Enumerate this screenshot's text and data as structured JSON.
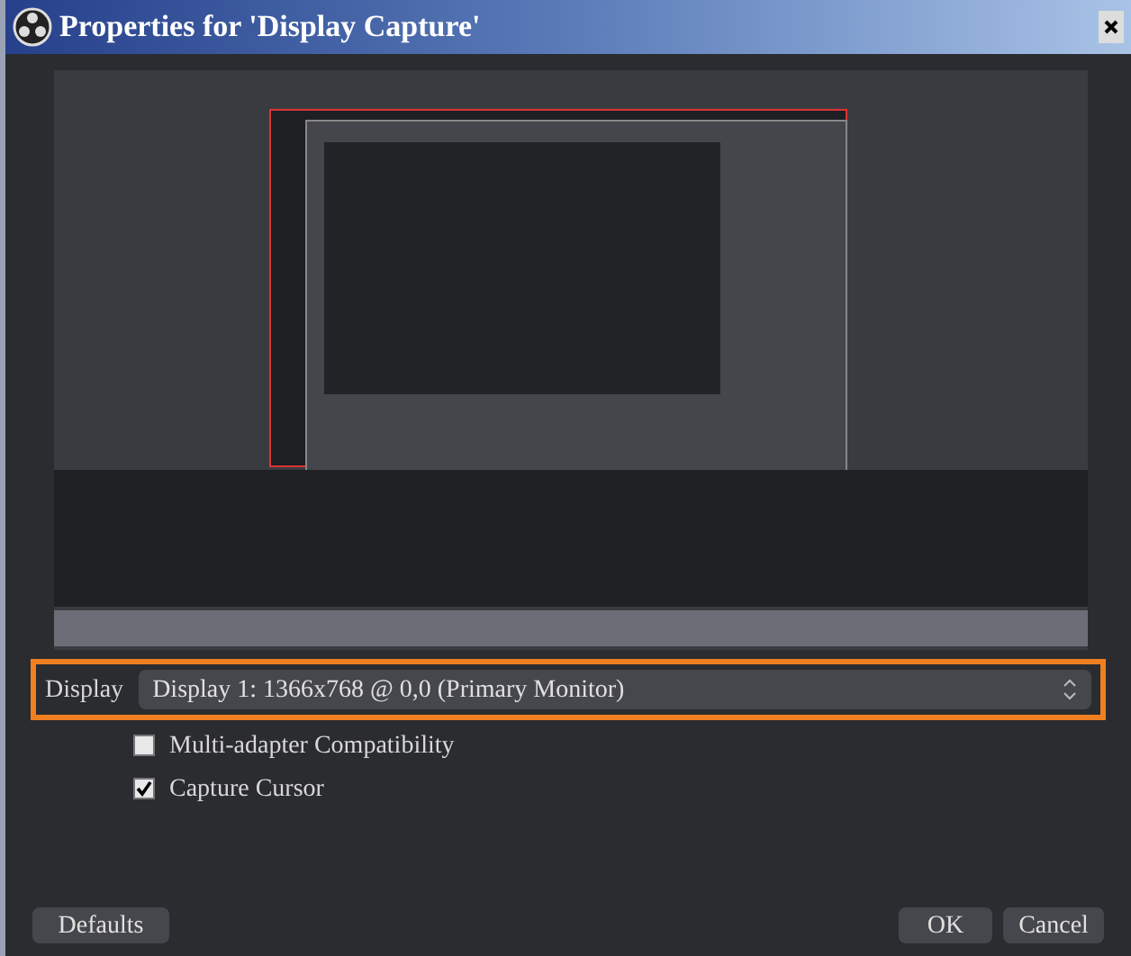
{
  "window": {
    "title": "Properties for 'Display Capture'"
  },
  "display": {
    "label": "Display",
    "value": "Display 1: 1366x768 @ 0,0 (Primary Monitor)",
    "highlighted": true
  },
  "options": [
    {
      "label": "Multi-adapter Compatibility",
      "checked": false
    },
    {
      "label": "Capture Cursor",
      "checked": true
    }
  ],
  "buttons": {
    "defaults": "Defaults",
    "ok": "OK",
    "cancel": "Cancel"
  }
}
